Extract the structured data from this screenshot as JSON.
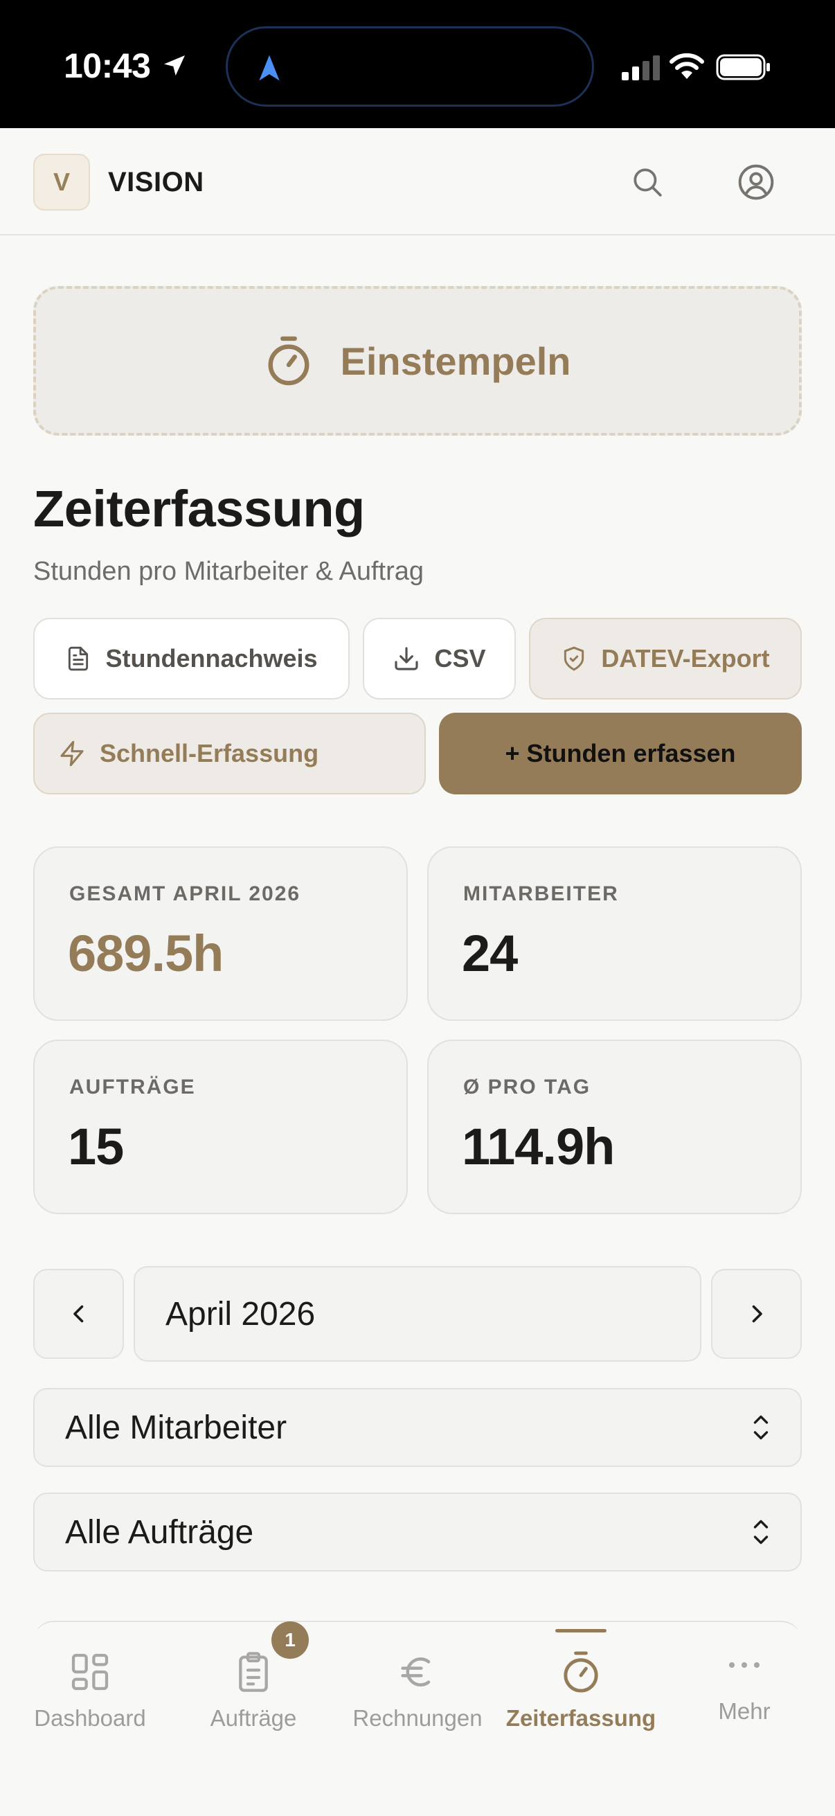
{
  "status_bar": {
    "time": "10:43"
  },
  "header": {
    "logo_letter": "V",
    "brand": "VISION"
  },
  "clock_in": {
    "label": "Einstempeln"
  },
  "page": {
    "title": "Zeiterfassung",
    "subtitle": "Stunden pro Mitarbeiter & Auftrag"
  },
  "actions": {
    "timesheet": "Stundennachweis",
    "csv": "CSV",
    "datev": "DATEV-Export",
    "quick": "Schnell-Erfassung",
    "add": "+ Stunden erfassen"
  },
  "stats": [
    {
      "label": "GESAMT APRIL 2026",
      "value": "689.5h"
    },
    {
      "label": "MITARBEITER",
      "value": "24"
    },
    {
      "label": "AUFTRÄGE",
      "value": "15"
    },
    {
      "label": "Ø PRO TAG",
      "value": "114.9h"
    }
  ],
  "filters": {
    "month": "April 2026",
    "employees": "Alle Mitarbeiter",
    "orders": "Alle Aufträge"
  },
  "tabbar": {
    "items": [
      {
        "label": "Dashboard"
      },
      {
        "label": "Aufträge",
        "badge": "1"
      },
      {
        "label": "Rechnungen"
      },
      {
        "label": "Zeiterfassung"
      },
      {
        "label": "Mehr"
      }
    ]
  },
  "colors": {
    "accent": "#957c58",
    "background": "#f8f8f7",
    "card": "#f3f3f2"
  }
}
